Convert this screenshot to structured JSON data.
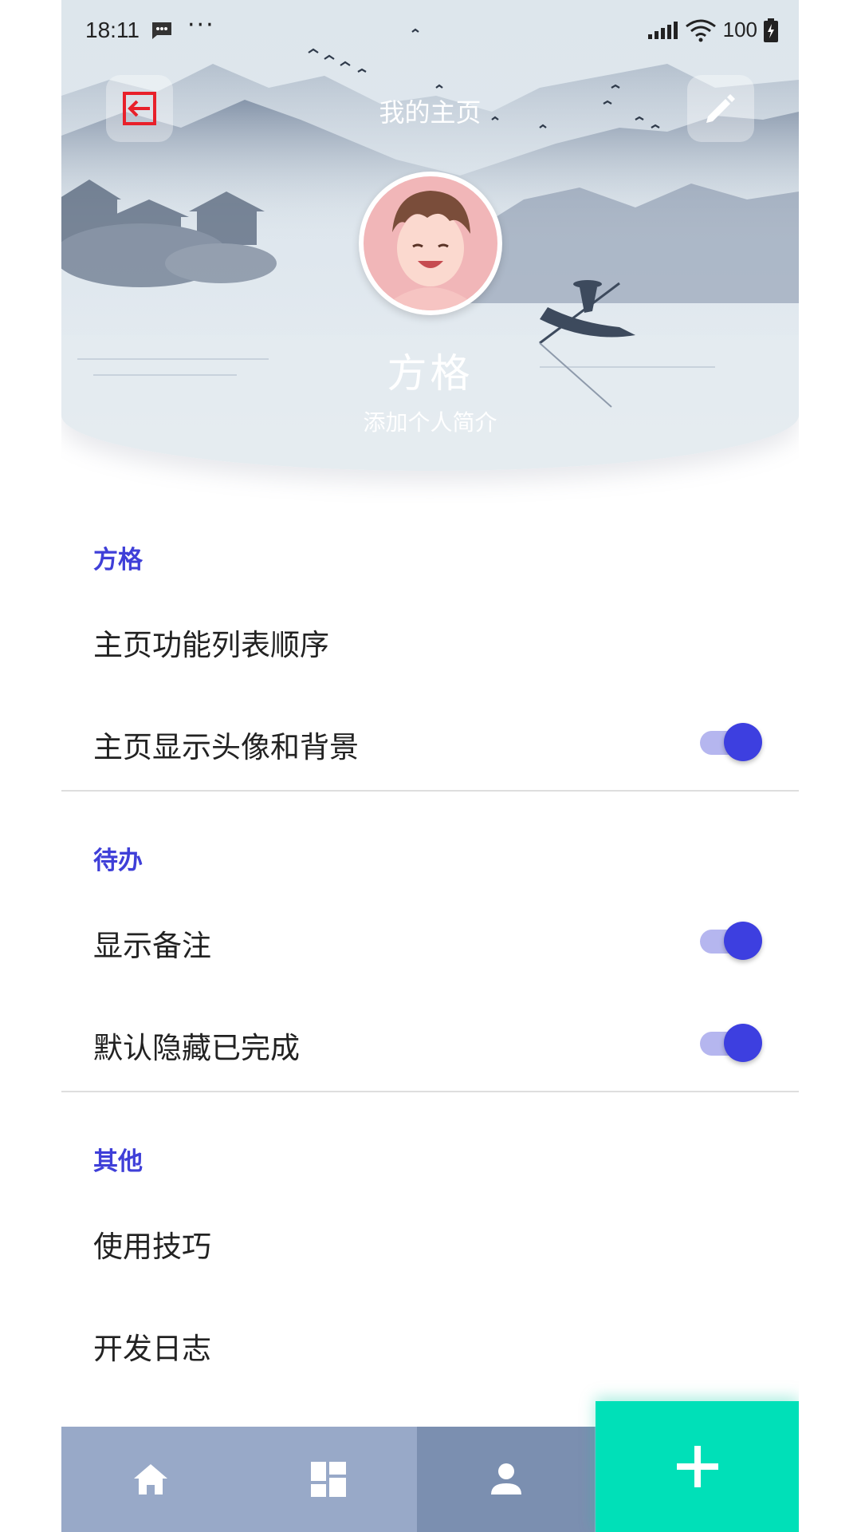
{
  "status_bar": {
    "time": "18:11",
    "dots": "···",
    "battery": "100",
    "icons": [
      "message-icon",
      "signal-icon",
      "wifi-icon",
      "battery-icon"
    ]
  },
  "header": {
    "title": "我的主页",
    "exit_icon": "exit-icon",
    "edit_icon": "pencil-icon"
  },
  "profile": {
    "name": "方格",
    "bio": "添加个人简介"
  },
  "sections": [
    {
      "title": "方格",
      "items": [
        {
          "label": "主页功能列表顺序"
        },
        {
          "label": "主页显示头像和背景",
          "toggle": true
        }
      ]
    },
    {
      "title": "待办",
      "items": [
        {
          "label": "显示备注",
          "toggle": true
        },
        {
          "label": "默认隐藏已完成",
          "toggle": true
        }
      ]
    },
    {
      "title": "其他",
      "items": [
        {
          "label": "使用技巧"
        },
        {
          "label": "开发日志"
        }
      ]
    }
  ],
  "bottom_nav": {
    "items": [
      "home-icon",
      "dashboard-icon",
      "person-icon"
    ],
    "active": "person-icon",
    "fab_icon": "plus-icon"
  },
  "colors": {
    "accent": "#3f3fd8",
    "toggle_on": "#3d3fe0",
    "nav_bg": "#98a9c8",
    "nav_active": "#7b8fb0",
    "fab": "#00e0b8",
    "exit_icon": "#e8202a"
  }
}
